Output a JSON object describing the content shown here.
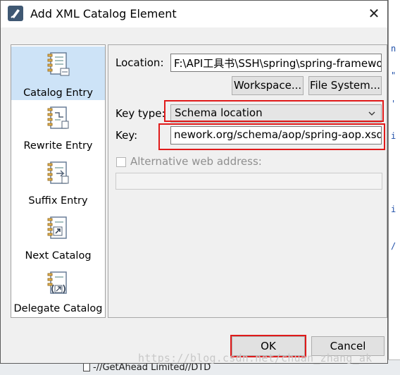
{
  "window": {
    "title": "Add XML Catalog Element",
    "close_glyph": "✕"
  },
  "catalog_items": [
    {
      "label": "Catalog Entry",
      "icon": "catalog-entry-icon",
      "selected": true
    },
    {
      "label": "Rewrite Entry",
      "icon": "rewrite-entry-icon",
      "selected": false
    },
    {
      "label": "Suffix Entry",
      "icon": "suffix-entry-icon",
      "selected": false
    },
    {
      "label": "Next Catalog",
      "icon": "next-catalog-icon",
      "selected": false
    },
    {
      "label": "Delegate Catalog",
      "icon": "delegate-catalog-icon",
      "selected": false
    }
  ],
  "form": {
    "location_label": "Location:",
    "location_value": "F:\\API工具书\\SSH\\spring\\spring-framewo",
    "workspace_button": "Workspace...",
    "file_system_button": "File System...",
    "key_type_label": "Key type:",
    "key_type_value": "Schema location",
    "key_label": "Key:",
    "key_value": "nework.org/schema/aop/spring-aop.xsd",
    "alt_web_address_label": "Alternative web address:",
    "alt_web_address_checked": false,
    "alt_web_address_value": ""
  },
  "buttons": {
    "ok": "OK",
    "cancel": "Cancel"
  },
  "background": {
    "bottom_text": "-//GetAhead Limited//DTD"
  },
  "watermark": "https://blog.csdn.net/chuan_zhang_ak",
  "colors": {
    "selection": "#cde3f7",
    "highlight_box": "#e01a1a",
    "title_icon": "#3f5873"
  }
}
